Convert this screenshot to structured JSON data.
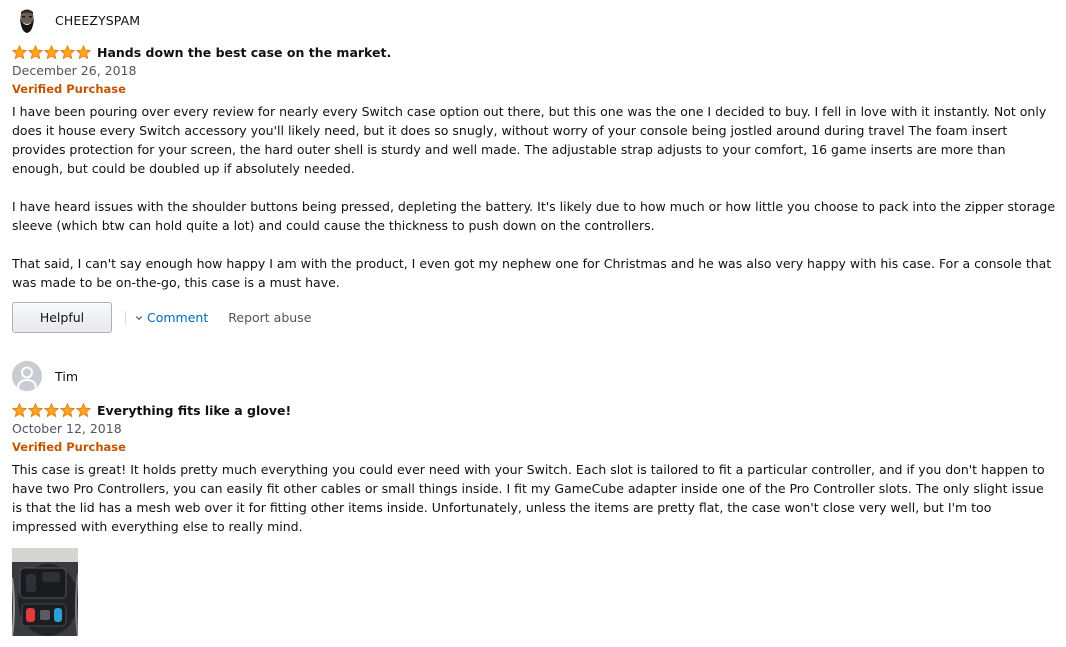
{
  "reviews": [
    {
      "profile_name": "CHEEZYSPAM",
      "avatar": "bearded-man-avatar",
      "rating": 5,
      "title": "Hands down the best case on the market.",
      "date": "December 26, 2018",
      "verified": "Verified Purchase",
      "paragraphs": [
        "I have been pouring over every review for nearly every Switch case option out there, but this one was the one I decided to buy. I fell in love with it instantly. Not only does it house every Switch accessory you'll likely need, but it does so snugly, without worry of your console being jostled around during travel The foam insert provides protection for your screen, the hard outer shell is sturdy and well made. The adjustable strap adjusts to your comfort, 16 game inserts are more than enough, but could be doubled up if absolutely needed.",
        "I have heard issues with the shoulder buttons being pressed, depleting the battery. It's likely due to how much or how little you choose to pack into the zipper storage sleeve (which btw can hold quite a lot) and could cause the thickness to push down on the controllers.",
        "That said, I can't say enough how happy I am with the product, I even got my nephew one for Christmas and he was also very happy with his case. For a console that was made to be on-the-go, this case is a must have."
      ],
      "helpful_label": "Helpful",
      "comment_label": "Comment",
      "report_label": "Report abuse"
    },
    {
      "profile_name": "Tim",
      "avatar": "default-user-avatar",
      "rating": 5,
      "title": "Everything fits like a glove!",
      "date": "October 12, 2018",
      "verified": "Verified Purchase",
      "paragraphs": [
        "This case is great! It holds pretty much everything you could ever need with your Switch. Each slot is tailored to fit a particular controller, and if you don't happen to have two Pro Controllers, you can easily fit other cables or small things inside. I fit my GameCube adapter inside one of the Pro Controller slots. The only slight issue is that the lid has a mesh web over it for fitting other items inside. Unfortunately, unless the items are pretty flat, the case won't close very well, but I'm too impressed with everything else to really mind."
      ],
      "photo": "case-photo-thumbnail"
    }
  ],
  "colors": {
    "star": "#ffa41c",
    "verified": "#c45500",
    "link": "#0066c0",
    "muted": "#555555"
  }
}
